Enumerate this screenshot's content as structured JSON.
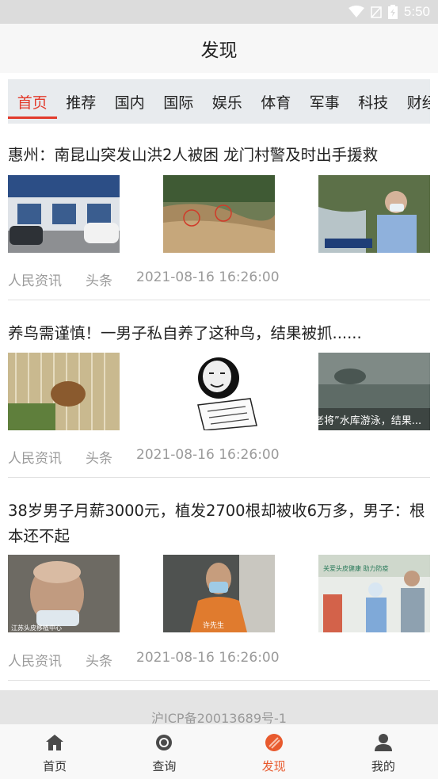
{
  "status_bar": {
    "time": "5:50",
    "icons": [
      "wifi-icon",
      "signal-icon",
      "battery-icon"
    ]
  },
  "header": {
    "title": "发现"
  },
  "tabs": [
    {
      "label": "首页",
      "active": true
    },
    {
      "label": "推荐"
    },
    {
      "label": "国内"
    },
    {
      "label": "国际"
    },
    {
      "label": "娱乐"
    },
    {
      "label": "体育"
    },
    {
      "label": "军事"
    },
    {
      "label": "科技"
    },
    {
      "label": "财经"
    }
  ],
  "news": [
    {
      "title": "惠州：南昆山突发山洪2人被困 龙门村警及时出手援救",
      "source": "人民资讯",
      "tag": "头条",
      "time": "2021-08-16 16:26:00",
      "thumbs": [
        "police-station-photo",
        "flood-river-photo",
        "police-officer-photo"
      ]
    },
    {
      "title": "养鸟需谨慎！一男子私自养了这种鸟，结果被抓......",
      "source": "人民资讯",
      "tag": "头条",
      "time": "2021-08-16 16:26:00",
      "thumbs": [
        "birdcage-photo",
        "meme-face-image",
        "reservoir-swim-video-thumb"
      ],
      "thumb_caption": "老将”水库游泳，结果..."
    },
    {
      "title": "38岁男子月薪3000元，植发2700根却被收6万多，男子：根本还不起",
      "source": "人民资讯",
      "tag": "头条",
      "time": "2021-08-16 16:26:00",
      "thumbs": [
        "bald-man-photo",
        "man-orange-shirt-photo",
        "hospital-event-photo"
      ],
      "thumb_caption_1": "江苏头皮移植中心",
      "thumb_caption_2": "许先生",
      "thumb_caption_3": "关爱头皮健康 助力防疫"
    }
  ],
  "footer": {
    "icp": "沪ICP备20013689号-1"
  },
  "bottom_nav": [
    {
      "label": "首页",
      "icon": "home-icon"
    },
    {
      "label": "查询",
      "icon": "search-icon"
    },
    {
      "label": "发现",
      "icon": "discover-icon",
      "active": true
    },
    {
      "label": "我的",
      "icon": "user-icon"
    }
  ],
  "colors": {
    "accent_red": "#e23b2c",
    "nav_active": "#e85a2e",
    "meta_gray": "#9a9a9a"
  }
}
